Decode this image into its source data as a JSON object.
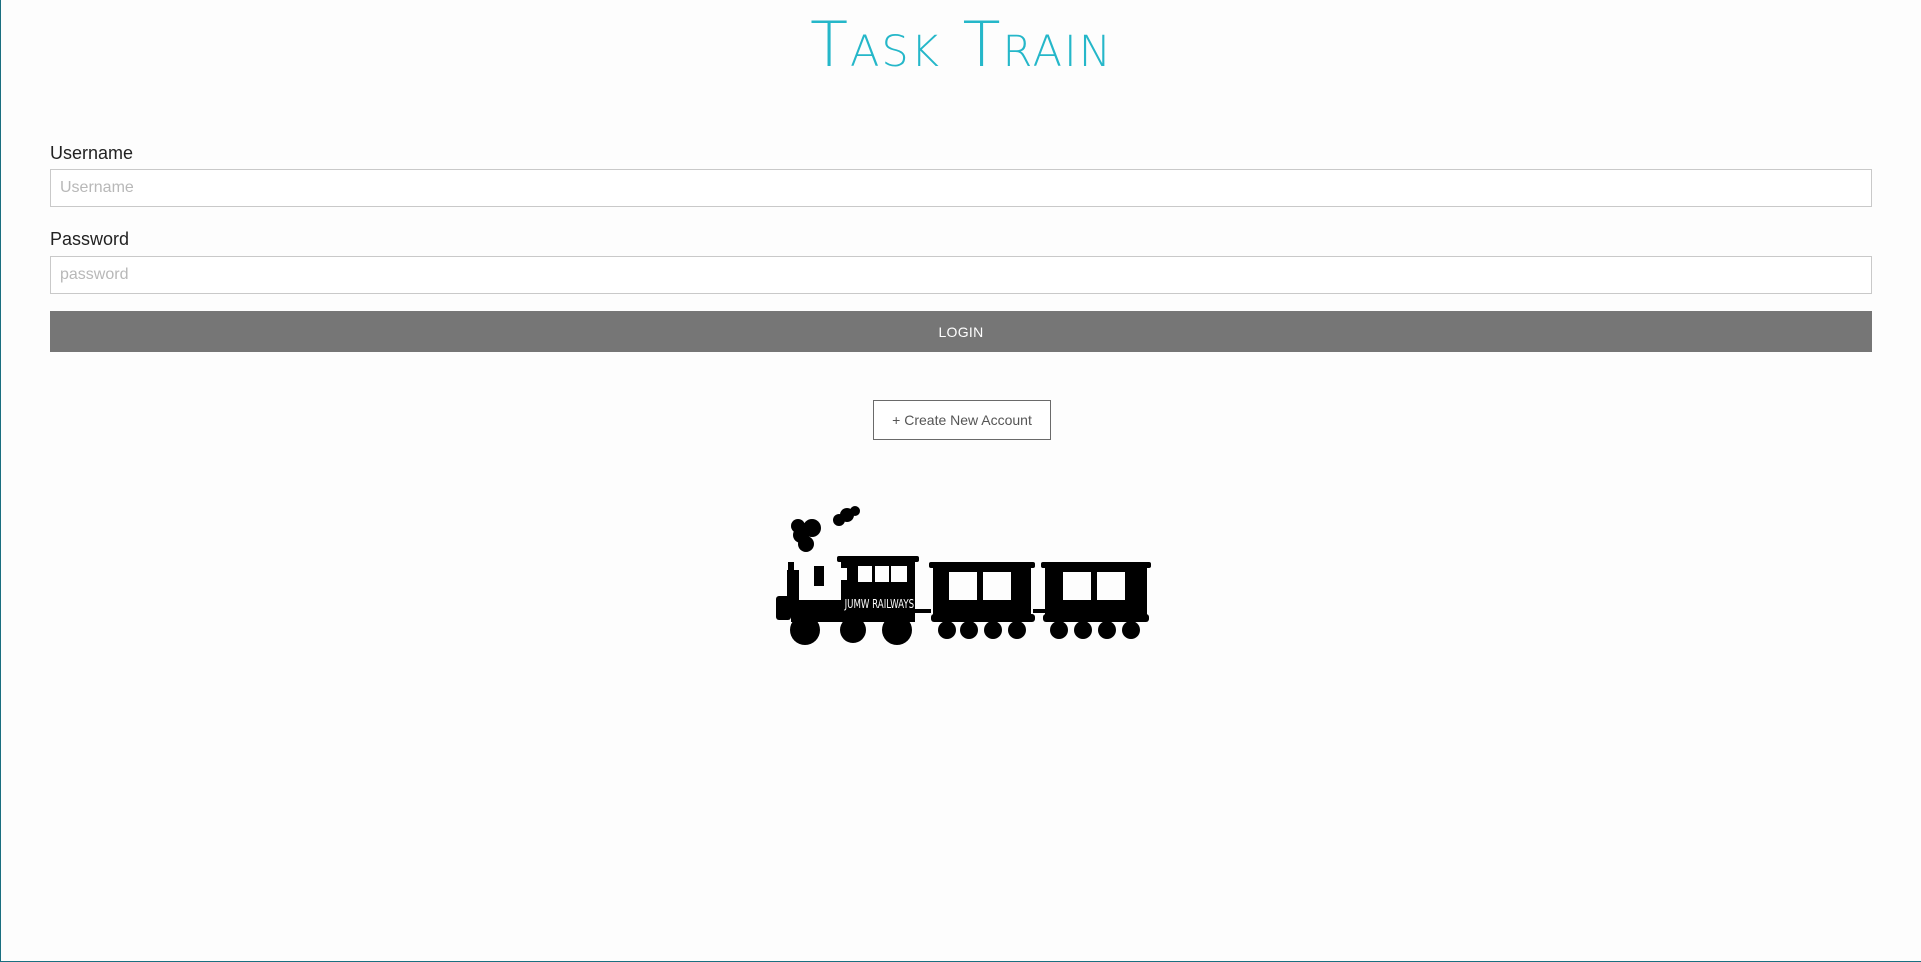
{
  "app": {
    "title": "Task Train"
  },
  "form": {
    "username_label": "Username",
    "username_placeholder": "Username",
    "password_label": "Password",
    "password_placeholder": "password",
    "login_label": "LOGIN",
    "create_account_label": "+ Create New Account"
  },
  "illustration": {
    "name": "train-icon",
    "text": "JUMW RAILWAYS"
  },
  "colors": {
    "title": "#25b7c9",
    "login_button": "#767676",
    "frame_border": "#1a6f80"
  }
}
